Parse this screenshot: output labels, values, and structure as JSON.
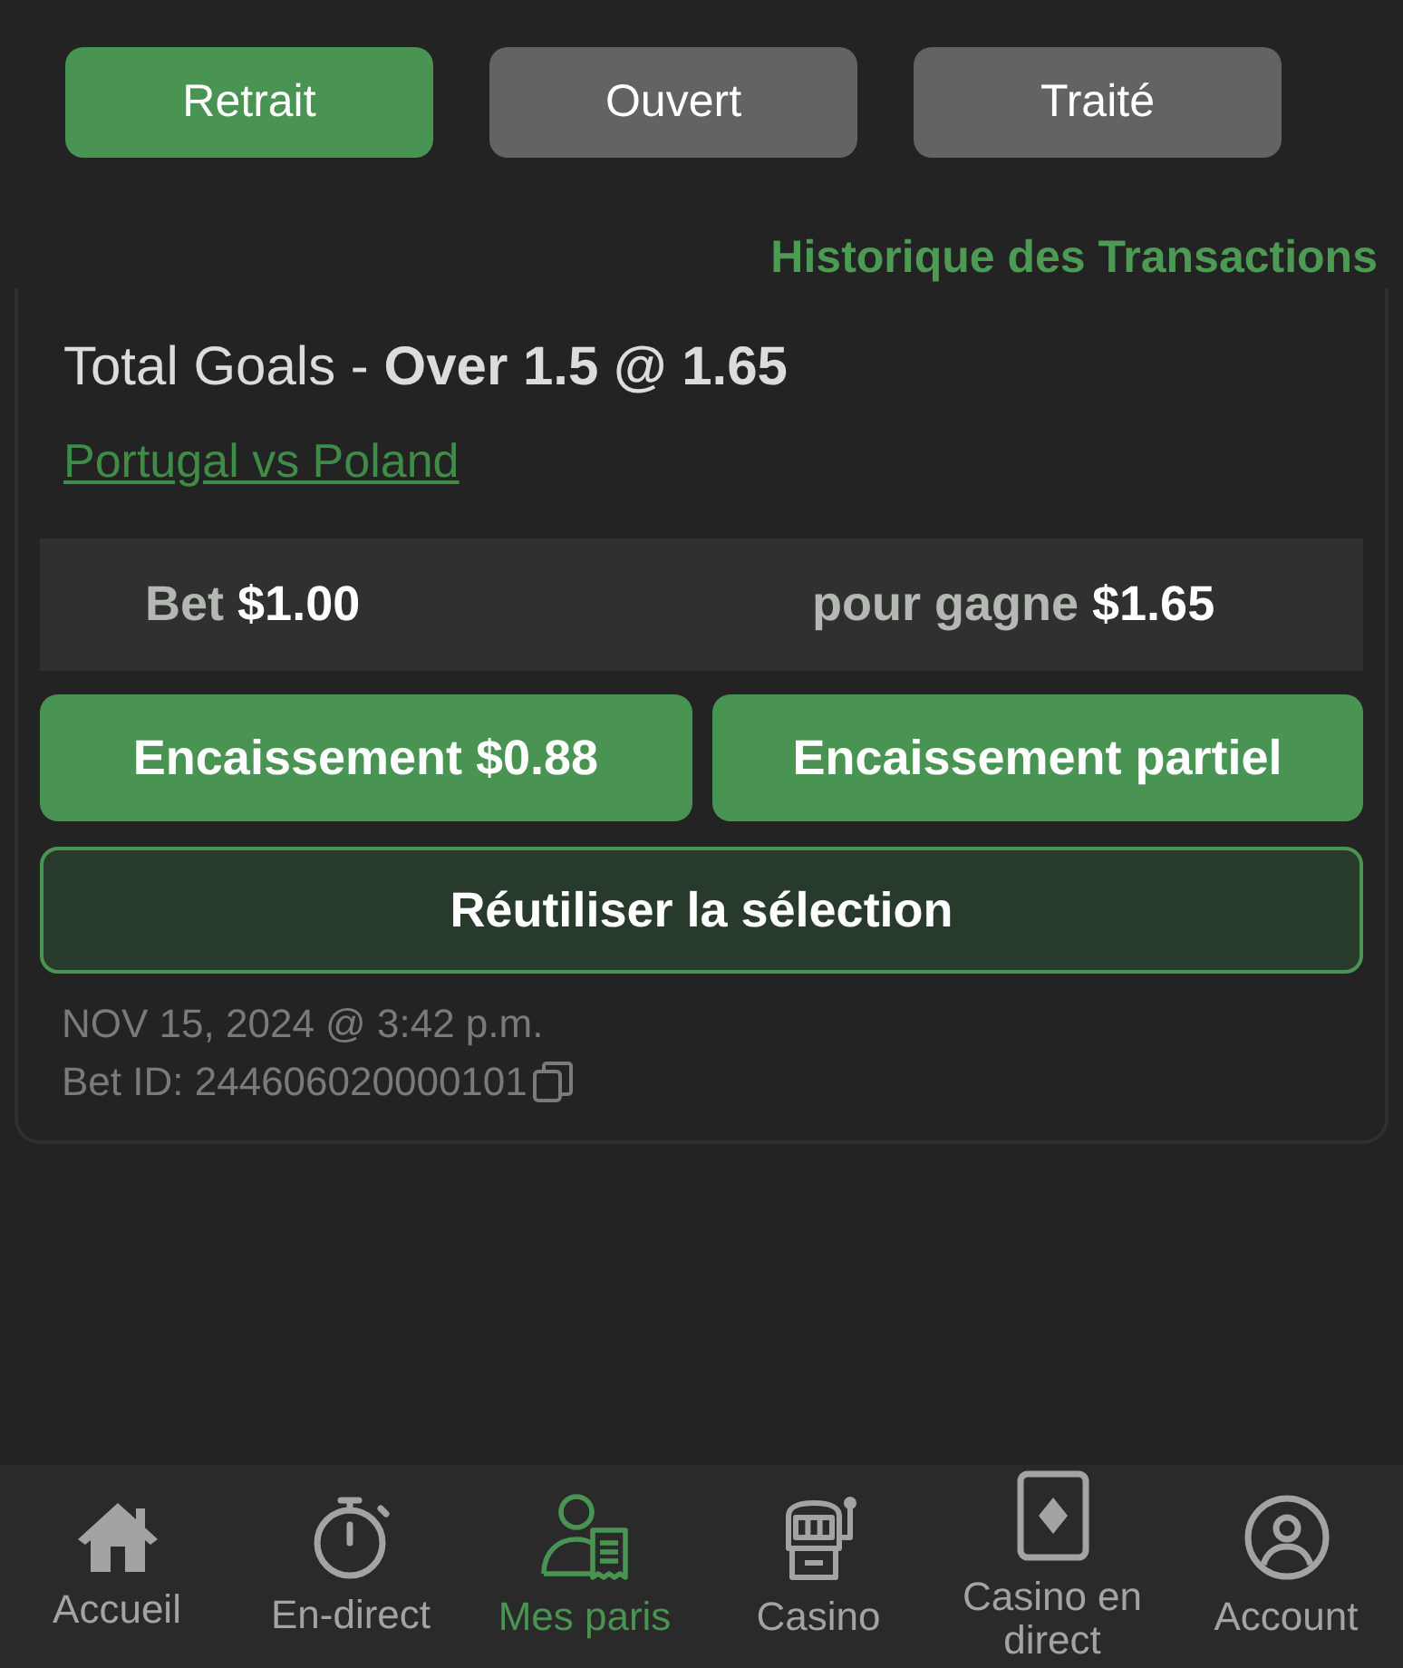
{
  "tabs": [
    {
      "label": "Retrait",
      "selected": true
    },
    {
      "label": "Ouvert",
      "selected": false
    },
    {
      "label": "Traité",
      "selected": false
    }
  ],
  "history_link": "Historique des Transactions",
  "bet": {
    "market": "Total Goals - **Over 1.5 @ 1.65**",
    "event": "Portugal vs Poland",
    "stake_label": "Bet",
    "stake": "$1.00",
    "payout_label": "pour gagne",
    "payout": "$1.65",
    "actions": [
      "Encaissement $0.88",
      "Encaissement partiel"
    ],
    "reuse": "Réutiliser la sélection",
    "placed": "NOV 15, 2024 @ 3:42 p.m.",
    "bet_id": "Bet ID: 244606020000101"
  },
  "nav": [
    {
      "label": "Accueil",
      "kind": "home",
      "selected": false
    },
    {
      "label": "En-direct",
      "kind": "stopwatch",
      "selected": false
    },
    {
      "label": "Mes paris",
      "kind": "bets",
      "selected": true
    },
    {
      "label": "Casino",
      "kind": "slot",
      "selected": false
    },
    {
      "label": "Casino en direct",
      "kind": "card",
      "selected": false
    },
    {
      "label": "Account",
      "kind": "account",
      "selected": false
    }
  ]
}
